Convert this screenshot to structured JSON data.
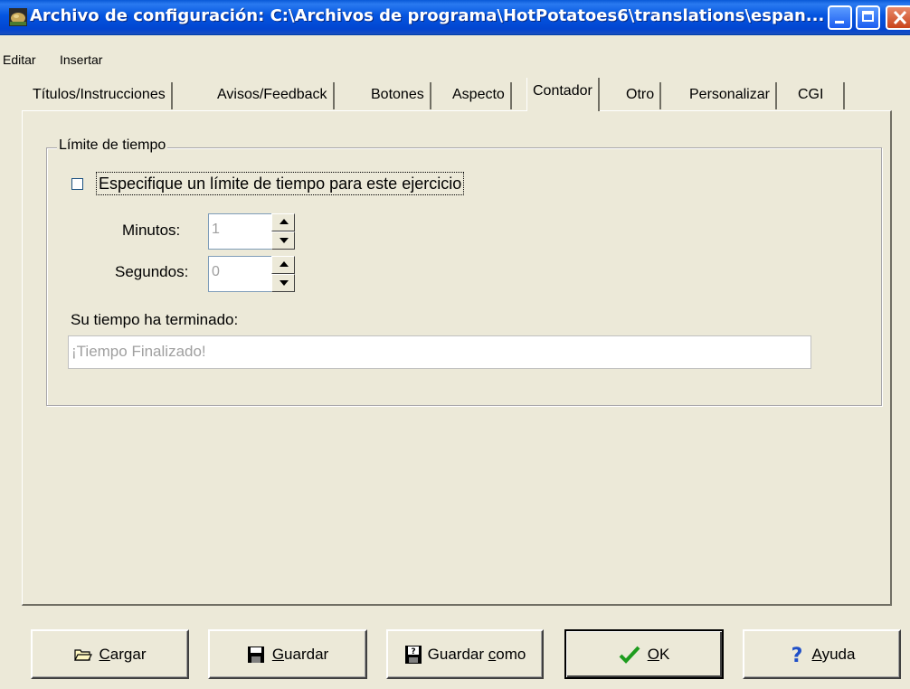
{
  "window": {
    "title": "Archivo de configuración: C:\\Archivos de programa\\HotPotatoes6\\translations\\espan..."
  },
  "menu": {
    "items": [
      "Editar",
      "Insertar"
    ]
  },
  "tabs": [
    {
      "label": "Títulos/Instrucciones",
      "active": false
    },
    {
      "label": "Avisos/Feedback",
      "active": false
    },
    {
      "label": "Botones",
      "active": false
    },
    {
      "label": "Aspecto",
      "active": false
    },
    {
      "label": "Contador",
      "active": true
    },
    {
      "label": "Otro",
      "active": false
    },
    {
      "label": "Personalizar",
      "active": false
    },
    {
      "label": "CGI",
      "active": false
    }
  ],
  "timer": {
    "group_label": "Límite de tiempo",
    "checkbox_label": "Especifique un límite de tiempo para este ejercicio",
    "checkbox_checked": false,
    "minutes_label": "Minutos:",
    "minutes_value": "1",
    "seconds_label": "Segundos:",
    "seconds_value": "0",
    "time_up_label": "Su tiempo ha terminado:",
    "time_up_message": "¡Tiempo Finalizado!"
  },
  "buttons": {
    "load": {
      "label_mnemonic": "C",
      "label_rest": "argar",
      "icon": "folder-open-icon"
    },
    "save": {
      "label_mnemonic": "G",
      "label_rest": "uardar",
      "icon": "floppy-disk-icon"
    },
    "save_as": {
      "label_prefix": "Guardar ",
      "label_mnemonic": "c",
      "label_rest": "omo",
      "icon": "floppy-question-icon"
    },
    "ok": {
      "label_mnemonic": "O",
      "label_rest": "K",
      "icon": "checkmark-icon"
    },
    "help": {
      "label_mnemonic": "A",
      "label_rest": "yuda",
      "icon": "question-mark-icon"
    }
  },
  "colors": {
    "titlebar": "#0455e0",
    "dialog_bg": "#ece9d8",
    "ok_check": "#1e9c1e",
    "help_question": "#1f4fc8"
  }
}
